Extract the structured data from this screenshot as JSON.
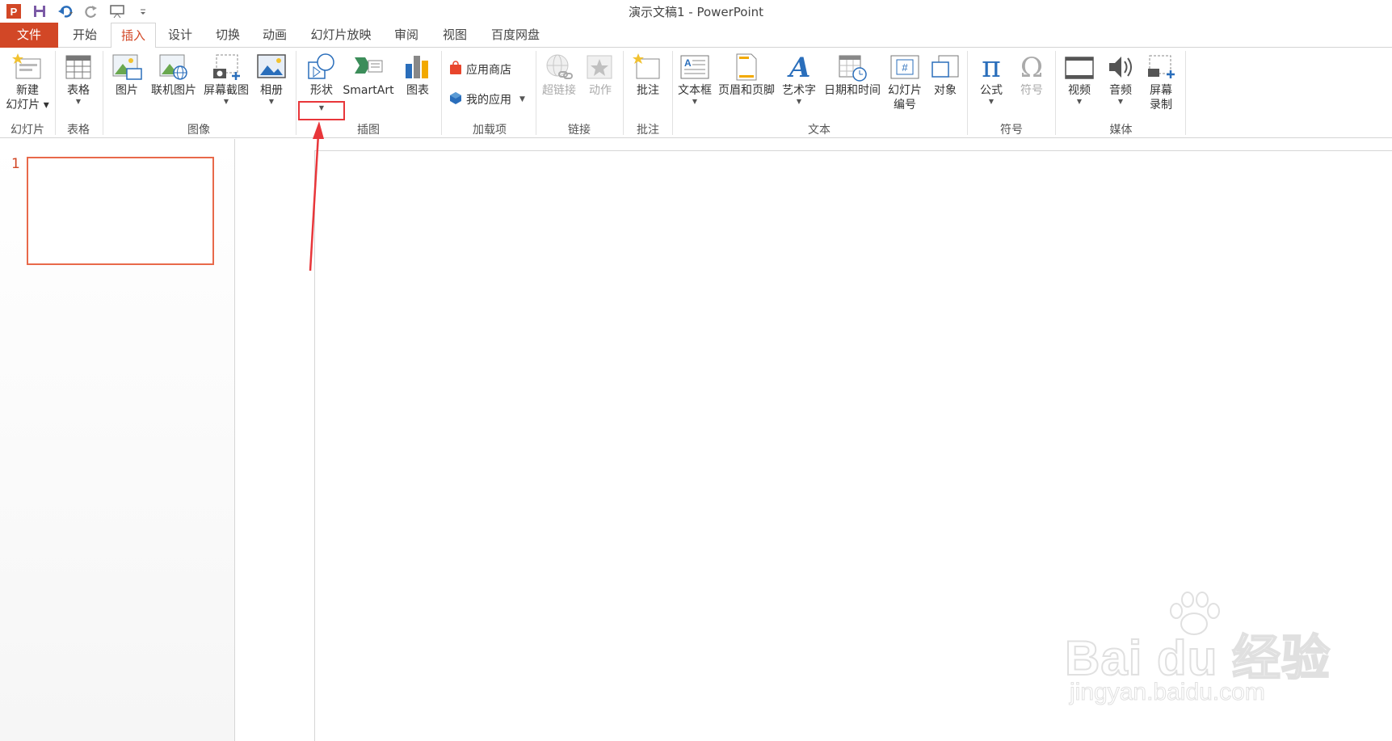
{
  "window": {
    "title": "演示文稿1 - PowerPoint"
  },
  "quick_access": [
    {
      "icon": "powerpoint-logo-icon"
    },
    {
      "icon": "save-icon"
    },
    {
      "icon": "undo-icon"
    },
    {
      "icon": "redo-icon"
    },
    {
      "icon": "start-from-beginning-icon"
    },
    {
      "icon": "customize-qat-icon"
    }
  ],
  "tabs": [
    {
      "label": "文件"
    },
    {
      "label": "开始"
    },
    {
      "label": "插入"
    },
    {
      "label": "设计"
    },
    {
      "label": "切换"
    },
    {
      "label": "动画"
    },
    {
      "label": "幻灯片放映"
    },
    {
      "label": "审阅"
    },
    {
      "label": "视图"
    },
    {
      "label": "百度网盘"
    }
  ],
  "active_tab": "插入",
  "ribbon": {
    "groups": {
      "slides": "幻灯片",
      "tables": "表格",
      "images": "图像",
      "illustrations": "插图",
      "addins": "加载项",
      "links": "链接",
      "comments": "批注",
      "text": "文本",
      "symbols": "符号",
      "media": "媒体"
    },
    "buttons": {
      "new_slide_1": "新建",
      "new_slide_2": "幻灯片",
      "table": "表格",
      "picture": "图片",
      "online_picture": "联机图片",
      "screenshot": "屏幕截图",
      "album": "相册",
      "shapes": "形状",
      "smartart": "SmartArt",
      "chart": "图表",
      "store": "应用商店",
      "my_apps": "我的应用",
      "hyperlink": "超链接",
      "action": "动作",
      "comment": "批注",
      "textbox": "文本框",
      "header_footer": "页眉和页脚",
      "wordart": "艺术字",
      "datetime": "日期和时间",
      "slide_number_1": "幻灯片",
      "slide_number_2": "编号",
      "object": "对象",
      "equation": "公式",
      "symbol": "符号",
      "video": "视频",
      "audio": "音频",
      "screen_rec_1": "屏幕",
      "screen_rec_2": "录制"
    }
  },
  "slides_pane": {
    "slide_number": "1"
  },
  "watermark": {
    "main": "Bai du 经验",
    "sub": "jingyan.baidu.com"
  },
  "colors": {
    "accent": "#d24726",
    "highlight": "#e8363a"
  }
}
